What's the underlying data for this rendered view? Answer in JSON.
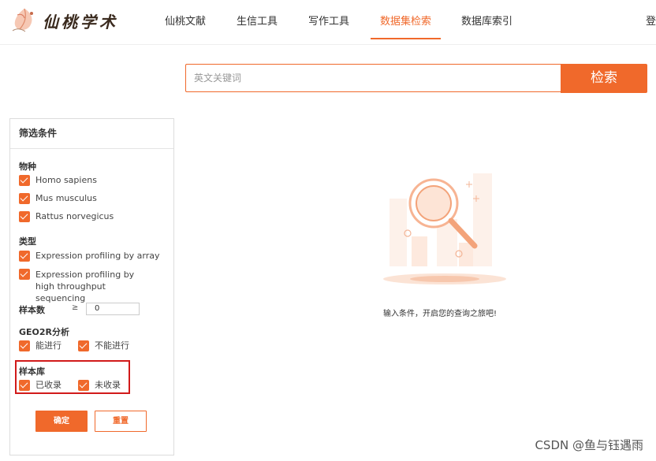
{
  "header": {
    "logo_text": "仙桃学术",
    "nav": [
      {
        "label": "仙桃文献"
      },
      {
        "label": "生信工具"
      },
      {
        "label": "写作工具"
      },
      {
        "label": "数据集检索",
        "active": true
      },
      {
        "label": "数据库索引"
      }
    ],
    "login": "登"
  },
  "search": {
    "placeholder": "英文关键词",
    "button": "检索"
  },
  "filter": {
    "title": "筛选条件",
    "species": {
      "label": "物种",
      "options": [
        {
          "label": "Homo sapiens",
          "checked": true
        },
        {
          "label": "Mus musculus",
          "checked": true
        },
        {
          "label": "Rattus norvegicus",
          "checked": true
        }
      ]
    },
    "type": {
      "label": "类型",
      "options": [
        {
          "label": "Expression profiling by array",
          "checked": true
        },
        {
          "label": "Expression profiling by high throughput sequencing",
          "checked": true
        }
      ]
    },
    "sample_count": {
      "label": "样本数",
      "operator": "≥",
      "value": "0"
    },
    "geo2r": {
      "label": "GEO2R分析",
      "options": [
        {
          "label": "能进行",
          "checked": true
        },
        {
          "label": "不能进行",
          "checked": true
        }
      ]
    },
    "sample_library": {
      "label": "样本库",
      "options": [
        {
          "label": "已收录",
          "checked": true
        },
        {
          "label": "未收录",
          "checked": true
        }
      ]
    },
    "confirm": "确定",
    "reset": "重置"
  },
  "empty_state": {
    "message": "输入条件，开启您的查询之旅吧!"
  },
  "watermark": "CSDN @鱼与钰遇雨",
  "colors": {
    "accent": "#f0692b",
    "highlight_border": "#d11a1a"
  }
}
